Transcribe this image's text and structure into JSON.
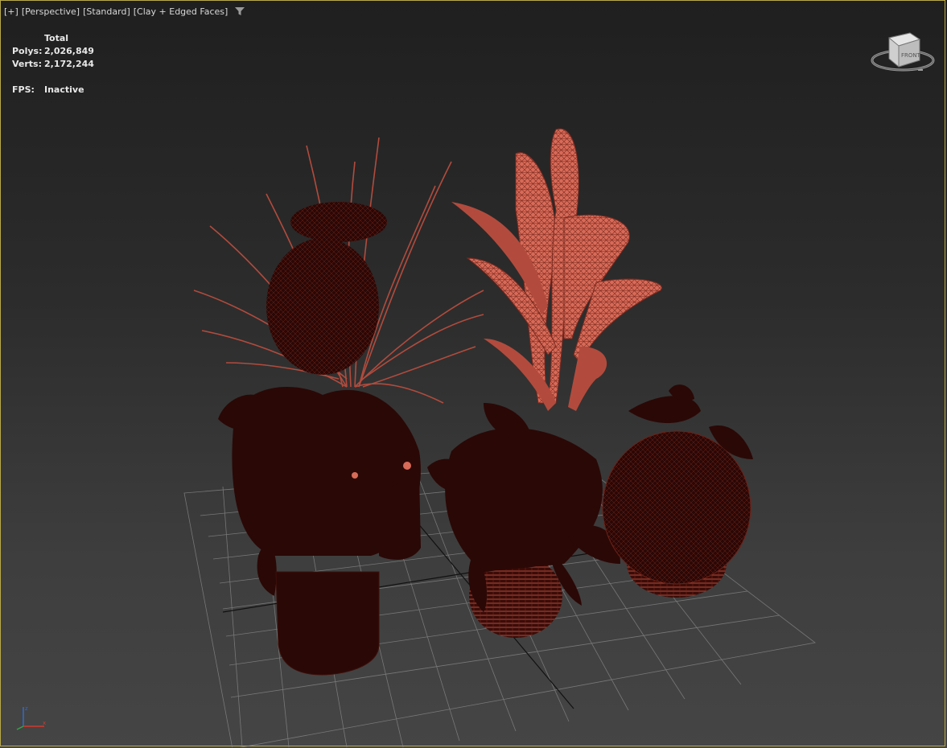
{
  "viewport": {
    "label_plus": "[+]",
    "label_view": "[Perspective]",
    "label_shading_standard": "[Standard]",
    "label_shading_mode": "[Clay + Edged Faces]"
  },
  "stats": {
    "header": "Total",
    "polys_label": "Polys:",
    "polys_value": "2,026,849",
    "verts_label": "Verts:",
    "verts_value": "2,172,244",
    "fps_label": "FPS:",
    "fps_value": "Inactive"
  },
  "viewcube": {
    "face_label": "FRONT"
  },
  "colors": {
    "mesh_dark": "#2a0806",
    "mesh_light": "#e0705e",
    "wire": "#b24b3d",
    "grid": "#8a8a8a",
    "viewport_border": "#b9a94a"
  },
  "icons": [
    "filter-icon",
    "viewcube-icon",
    "axis-tripod-icon"
  ]
}
